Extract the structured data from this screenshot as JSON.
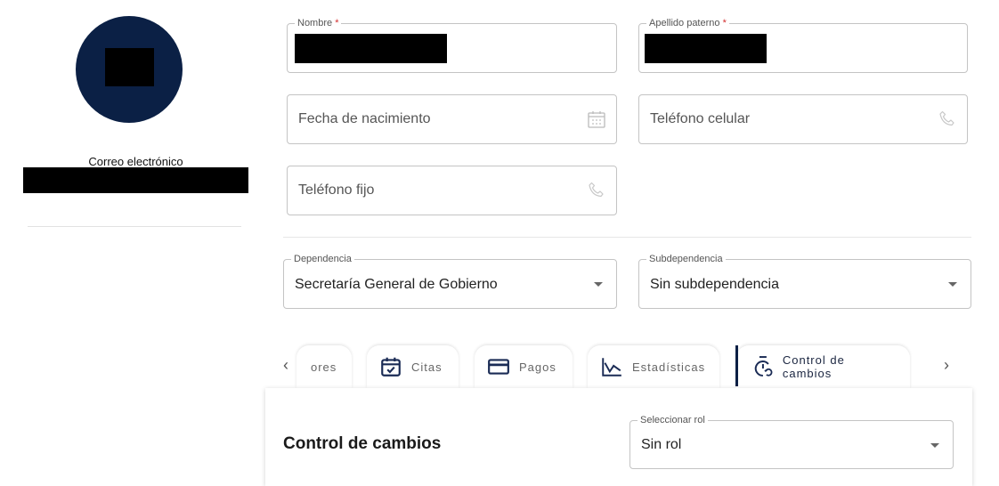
{
  "profile": {
    "email_label": "Correo electrónico"
  },
  "form": {
    "nombre": {
      "label": "Nombre",
      "required_mark": "*"
    },
    "apellido_paterno": {
      "label": "Apellido paterno",
      "required_mark": "*"
    },
    "fecha_nacimiento": {
      "placeholder": "Fecha de nacimiento",
      "icon": "calendar-icon"
    },
    "telefono_celular": {
      "placeholder": "Teléfono celular",
      "icon": "phone-icon"
    },
    "telefono_fijo": {
      "placeholder": "Teléfono fijo",
      "icon": "phone-icon"
    },
    "dependencia": {
      "label": "Dependencia",
      "value": "Secretaría General de Gobierno"
    },
    "subdependencia": {
      "label": "Subdependencia",
      "value": "Sin subdependencia"
    }
  },
  "tabs": {
    "prev_arrow": "‹",
    "next_arrow": "›",
    "items": [
      {
        "label": "ores",
        "icon": ""
      },
      {
        "label": "Citas",
        "icon": "calendar-check-icon"
      },
      {
        "label": "Pagos",
        "icon": "credit-card-icon"
      },
      {
        "label": "Estadísticas",
        "icon": "chart-line-icon"
      },
      {
        "label": "Control de cambios",
        "icon": "timer-sync-icon",
        "active": true
      }
    ]
  },
  "panel": {
    "title": "Control de cambios",
    "role_select": {
      "label": "Seleccionar rol",
      "value": "Sin rol"
    }
  },
  "colors": {
    "navy": "#0b2045",
    "required": "#d32f2f",
    "border": "#c4c4c4"
  }
}
